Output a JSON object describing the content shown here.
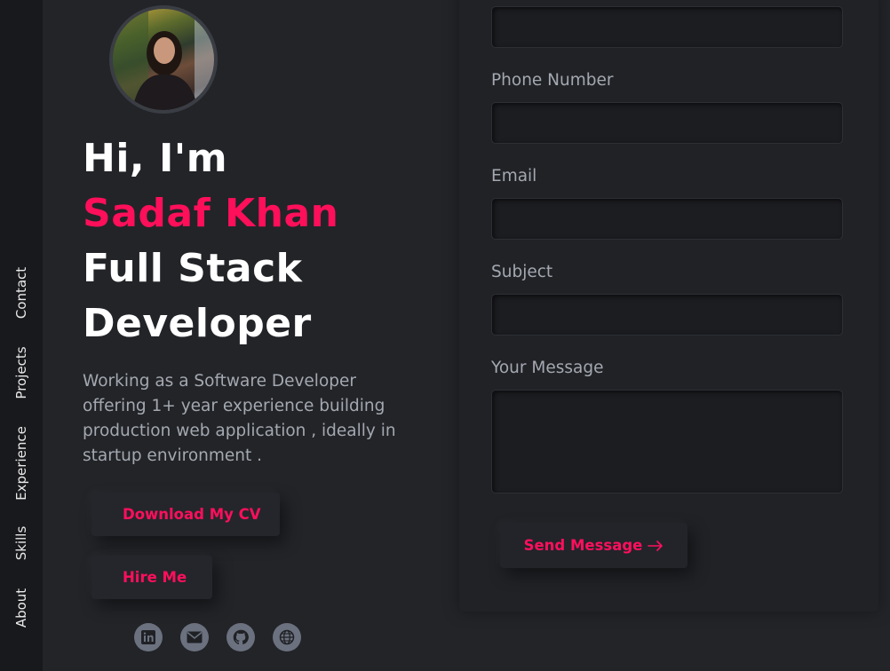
{
  "sidebar": {
    "items": [
      {
        "label": "Contact"
      },
      {
        "label": "Projects"
      },
      {
        "label": "Experience"
      },
      {
        "label": "Skills"
      },
      {
        "label": "About"
      }
    ]
  },
  "hero": {
    "greeting": "Hi, I'm ",
    "name": "Sadaf Khan",
    "role": "Full Stack Developer",
    "description": "Working as a Software Developer offering 1+ year experience building production web application , ideally in startup environment .",
    "download_cv_label": "Download My CV",
    "hire_me_label": "Hire Me",
    "accent_color": "#fe0f5a"
  },
  "social": [
    {
      "icon": "linkedin-icon"
    },
    {
      "icon": "mail-icon"
    },
    {
      "icon": "github-icon"
    },
    {
      "icon": "globe-icon"
    }
  ],
  "form": {
    "phone_label": "Phone Number",
    "email_label": "Email",
    "subject_label": "Subject",
    "message_label": "Your Message",
    "name_value": "",
    "phone_value": "",
    "email_value": "",
    "subject_value": "",
    "message_value": "",
    "send_label": "Send Message",
    "send_icon": "arrow-right-icon"
  }
}
